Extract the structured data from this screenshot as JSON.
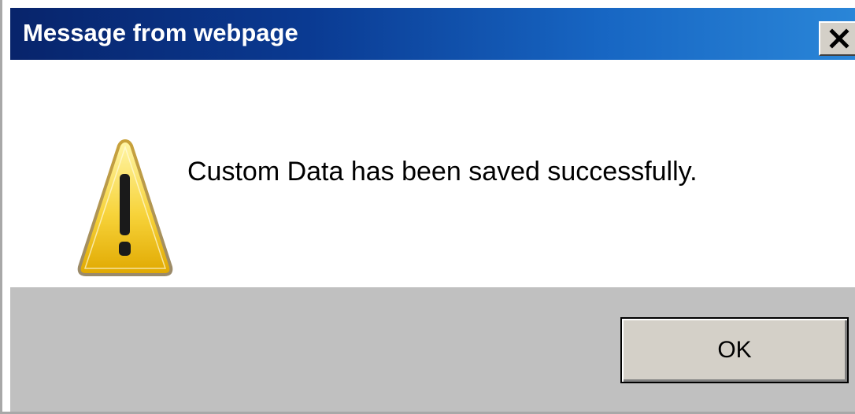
{
  "dialog": {
    "title": "Message from webpage",
    "message": "Custom Data has been saved successfully.",
    "icon": "warning-icon",
    "close_icon": "close-icon",
    "buttons": {
      "ok_label": "OK"
    }
  },
  "colors": {
    "titlebar_start": "#08246b",
    "titlebar_end": "#2a86d8",
    "footer_bg": "#c0c0c0",
    "button_face": "#d4d0c8"
  }
}
